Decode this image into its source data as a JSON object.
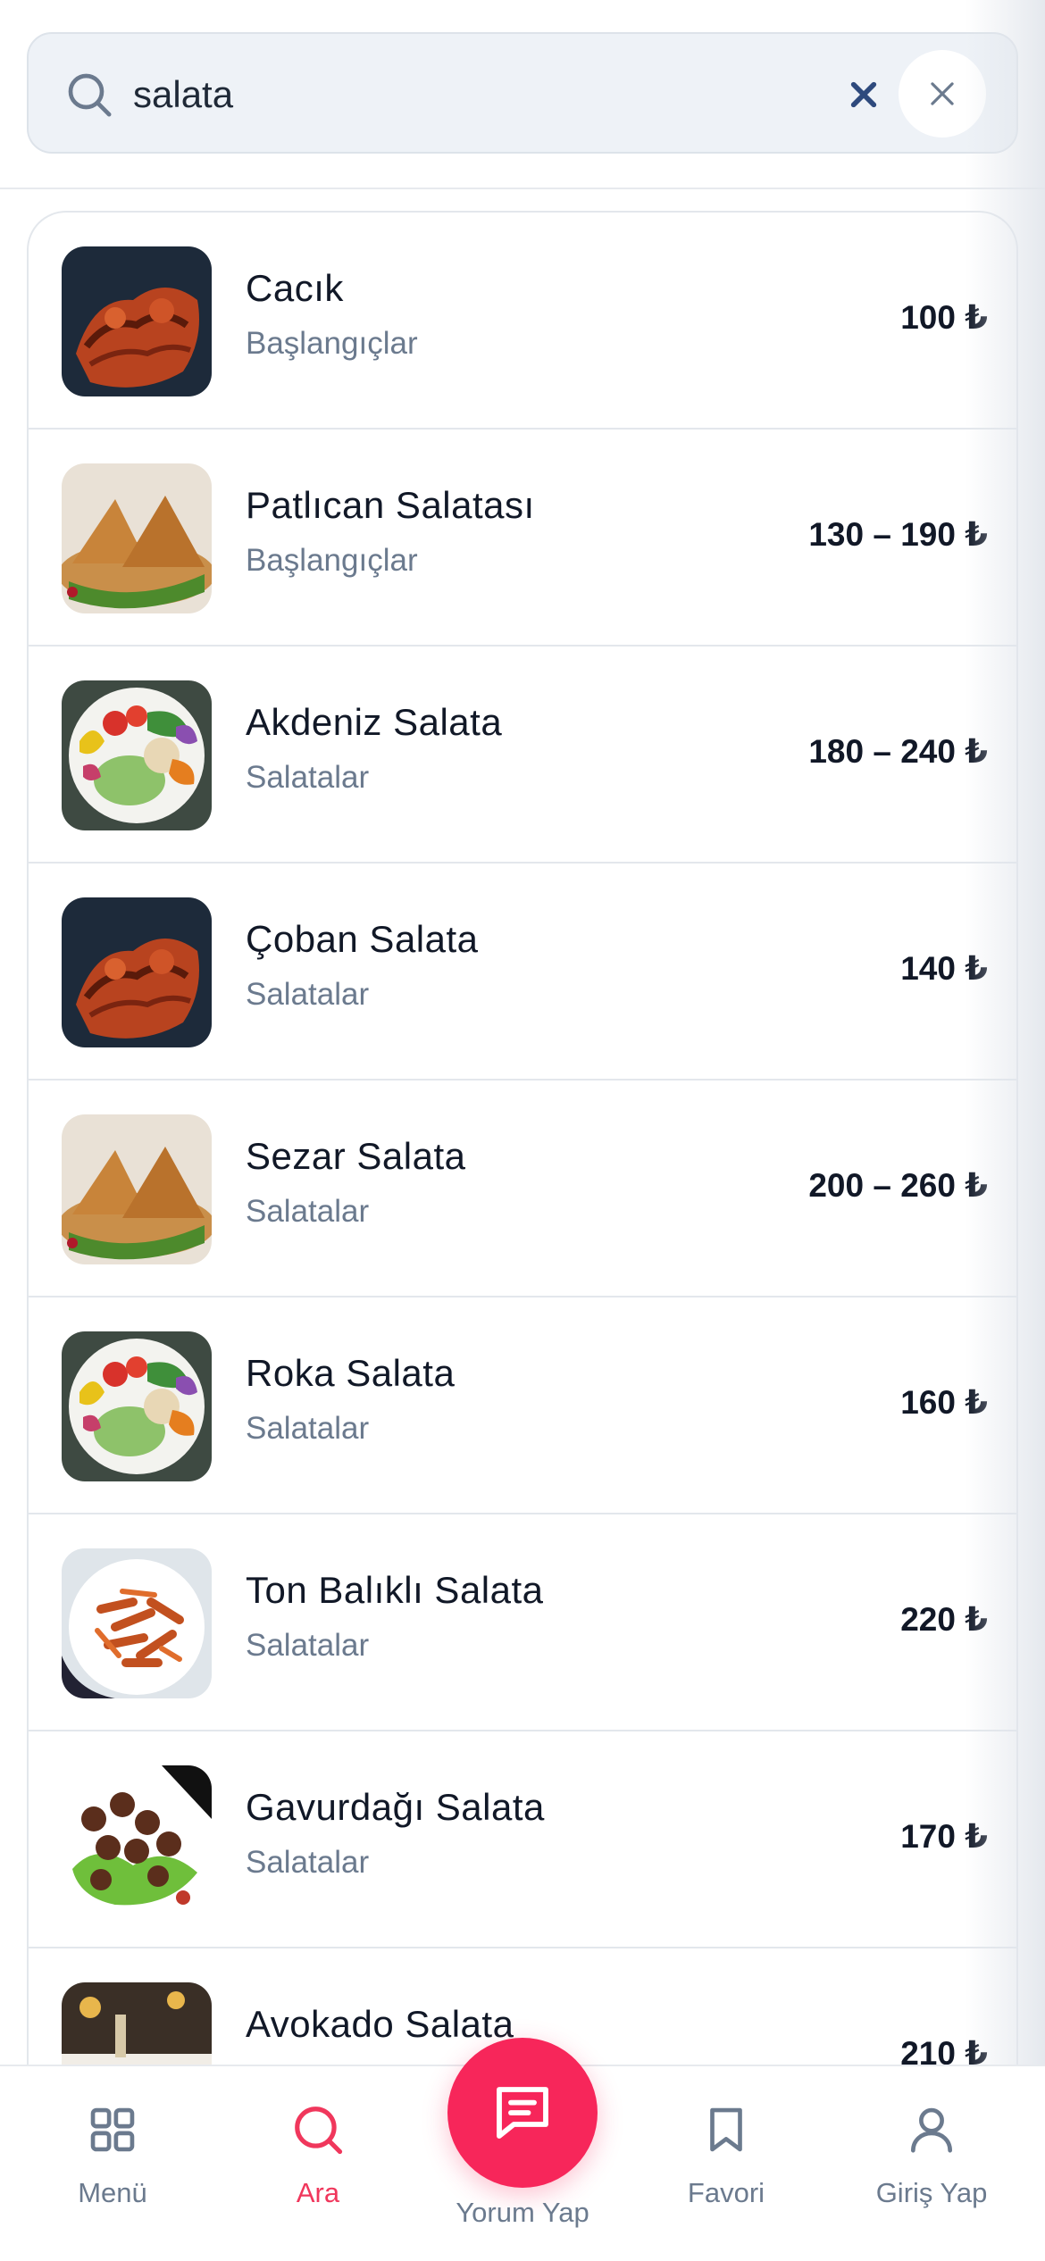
{
  "search": {
    "query": "salata"
  },
  "results": [
    {
      "name": "Cacık",
      "category": "Başlangıçlar",
      "price": "100 ₺",
      "image": "grilled-chicken"
    },
    {
      "name": "Patlıcan Salatası",
      "category": "Başlangıçlar",
      "price": "130 – 190 ₺",
      "image": "samosa"
    },
    {
      "name": "Akdeniz Salata",
      "category": "Salatalar",
      "price": "180 – 240 ₺",
      "image": "salad-bowl"
    },
    {
      "name": "Çoban Salata",
      "category": "Salatalar",
      "price": "140 ₺",
      "image": "grilled-chicken"
    },
    {
      "name": "Sezar Salata",
      "category": "Salatalar",
      "price": "200 – 260 ₺",
      "image": "samosa"
    },
    {
      "name": "Roka Salata",
      "category": "Salatalar",
      "price": "160 ₺",
      "image": "salad-bowl"
    },
    {
      "name": "Ton Balıklı Salata",
      "category": "Salatalar",
      "price": "220 ₺",
      "image": "pasta"
    },
    {
      "name": "Gavurdağı Salata",
      "category": "Salatalar",
      "price": "170 ₺",
      "image": "meatballs"
    },
    {
      "name": "Avokado Salata",
      "category": "",
      "price": "210 ₺",
      "image": "restaurant-table"
    }
  ],
  "nav": {
    "menu": "Menü",
    "search": "Ara",
    "review": "Yorum Yap",
    "favorites": "Favori",
    "login": "Giriş Yap"
  },
  "colors": {
    "accent": "#f7265a",
    "muted": "#6b7a8e",
    "clear_icon": "#2e4a7d"
  }
}
